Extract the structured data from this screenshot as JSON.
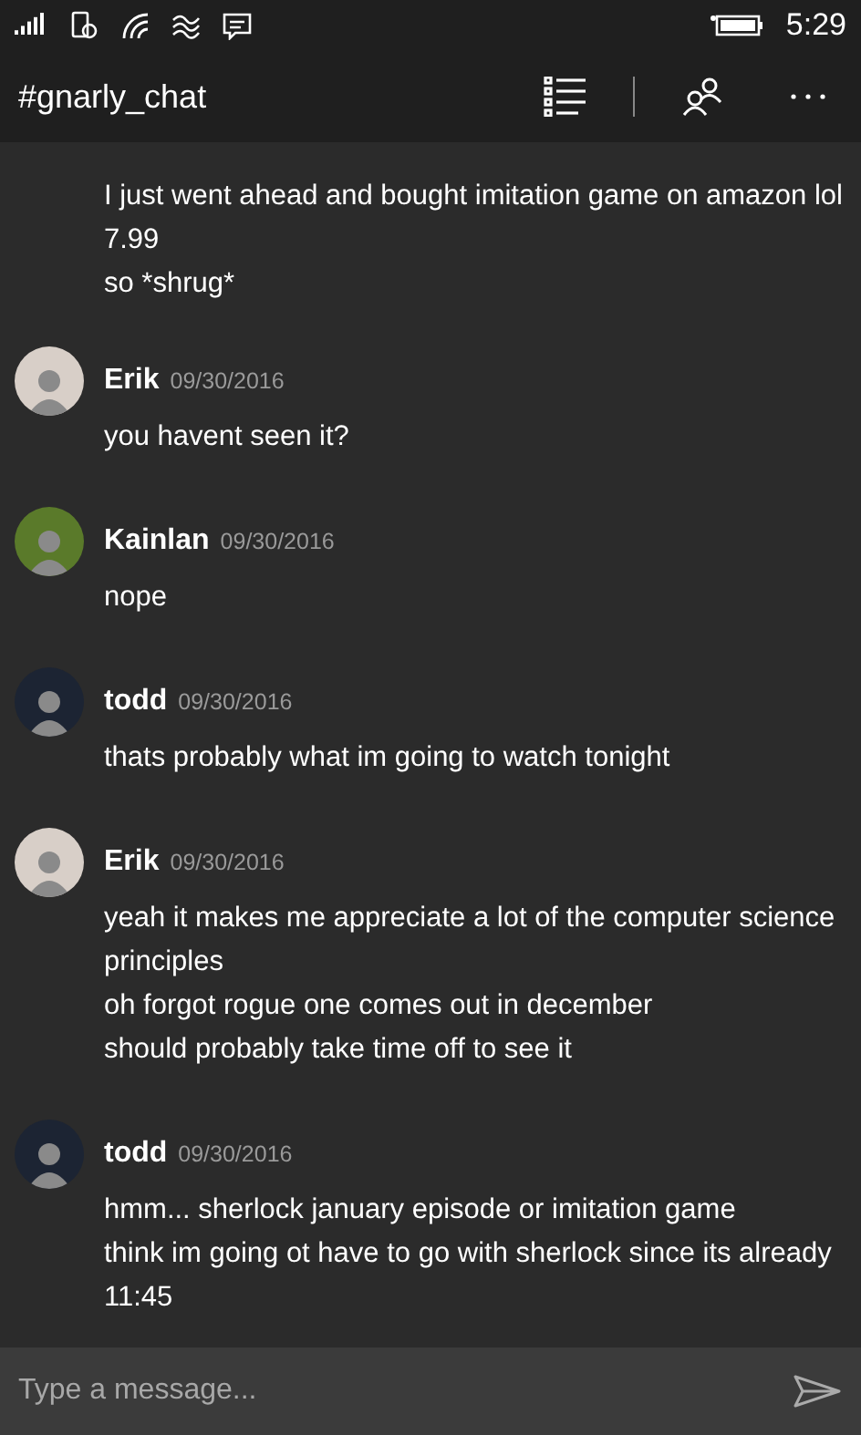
{
  "status_bar": {
    "time": "5:29"
  },
  "title_bar": {
    "title": "#gnarly_chat"
  },
  "messages": [
    {
      "kind": "continued",
      "lines": [
        "I just went ahead and bought imitation game on amazon lol",
        "7.99",
        "so *shrug*"
      ]
    },
    {
      "kind": "full",
      "author": "Erik",
      "date": "09/30/2016",
      "color": "#d8cfc8",
      "lines": [
        "you havent seen it?"
      ]
    },
    {
      "kind": "full",
      "author": "Kainlan",
      "date": "09/30/2016",
      "color": "#5a7a2a",
      "lines": [
        "nope"
      ]
    },
    {
      "kind": "full",
      "author": "todd",
      "date": "09/30/2016",
      "color": "#1c2433",
      "lines": [
        "thats probably what im going to watch tonight"
      ]
    },
    {
      "kind": "full",
      "author": "Erik",
      "date": "09/30/2016",
      "color": "#d8cfc8",
      "lines": [
        "yeah it makes me appreciate a lot of the computer science principles",
        "oh forgot rogue one comes out in december",
        "should probably take time off to see it"
      ]
    },
    {
      "kind": "full",
      "author": "todd",
      "date": "09/30/2016",
      "color": "#1c2433",
      "lines": [
        "hmm... sherlock january episode or imitation game",
        "think im going ot have to go with sherlock since its already 11:45"
      ]
    }
  ],
  "composer": {
    "placeholder": "Type a message..."
  }
}
